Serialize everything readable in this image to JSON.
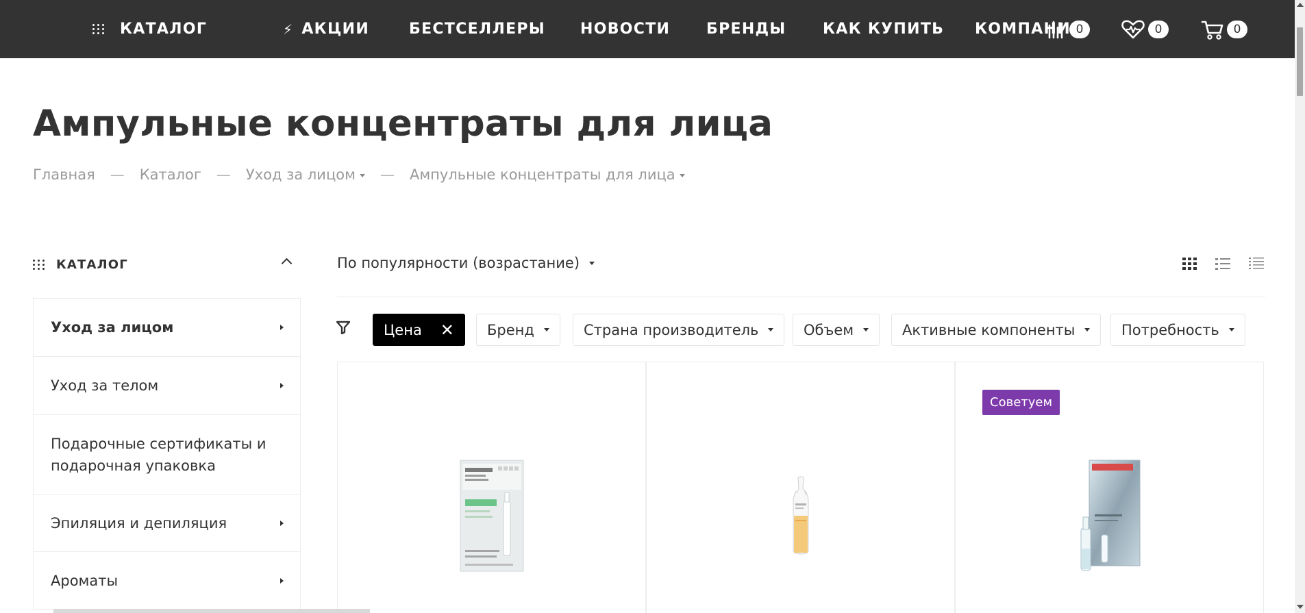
{
  "nav": {
    "catalog": "КАТАЛОГ",
    "promotions": "АКЦИИ",
    "bestsellers": "БЕСТСЕЛЛЕРЫ",
    "news": "НОВОСТИ",
    "brands": "БРЕНДЫ",
    "how_to_buy": "КАК КУПИТЬ",
    "company": "КОМПАНИЯ",
    "compare_count": "0",
    "favorites_count": "0",
    "cart_count": "0"
  },
  "page": {
    "title": "Ампульные концентраты для лица"
  },
  "breadcrumbs": [
    {
      "label": "Главная",
      "dropdown": false
    },
    {
      "label": "Каталог",
      "dropdown": false
    },
    {
      "label": "Уход за лицом",
      "dropdown": true
    },
    {
      "label": "Ампульные концентраты для лица",
      "dropdown": true
    }
  ],
  "sidebar": {
    "heading": "КАТАЛОГ",
    "items": [
      {
        "label": "Уход за лицом",
        "active": true,
        "has_children": true
      },
      {
        "label": "Уход за телом",
        "active": false,
        "has_children": true
      },
      {
        "label": "Подарочные сертификаты и подарочная упаковка",
        "active": false,
        "has_children": false
      },
      {
        "label": "Эпиляция и депиляция",
        "active": false,
        "has_children": true
      },
      {
        "label": "Ароматы",
        "active": false,
        "has_children": true
      }
    ]
  },
  "sort": {
    "selected": "По популярности (возрастание)"
  },
  "views": [
    "grid-view-icon",
    "list-view-icon",
    "compact-list-icon"
  ],
  "filters": [
    {
      "label": "Цена",
      "selected": true
    },
    {
      "label": "Бренд",
      "selected": false
    },
    {
      "label": "Страна производитель",
      "selected": false
    },
    {
      "label": "Объем",
      "selected": false
    },
    {
      "label": "Активные компоненты",
      "selected": false
    },
    {
      "label": "Потребность",
      "selected": false
    }
  ],
  "products": [
    {
      "badge": "",
      "image": "babor-ampoule-box"
    },
    {
      "badge": "",
      "image": "single-ampoule"
    },
    {
      "badge": "Советуем",
      "image": "biodroga-ampoule-box"
    }
  ],
  "colors": {
    "topbar": "#333333",
    "badge": "#7d3aab",
    "selected_chip": "#000000"
  }
}
